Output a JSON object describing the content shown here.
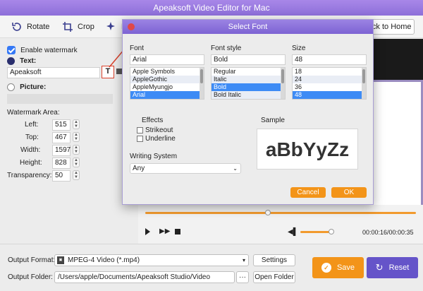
{
  "window": {
    "title": "Apeaksoft Video Editor for Mac"
  },
  "toolbar": {
    "rotate": "Rotate",
    "crop": "Crop",
    "effect_partial": "E",
    "back": "Back to Home"
  },
  "watermark": {
    "enable_label": "Enable watermark",
    "text_label": "Text:",
    "text_value": "Apeaksoft",
    "picture_label": "Picture:",
    "area_label": "Watermark Area:",
    "left_label": "Left:",
    "left_value": "515",
    "top_label": "Top:",
    "top_value": "467",
    "width_label": "Width:",
    "width_value": "1597",
    "height_label": "Height:",
    "height_value": "828",
    "transparency_label": "Transparency:",
    "transparency_value": "50"
  },
  "dialog": {
    "title": "Select Font",
    "font_label": "Font",
    "font_value": "Arial",
    "fonts": [
      "Apple Symbols",
      "AppleGothic",
      "AppleMyungjo",
      "Arial"
    ],
    "style_label": "Font style",
    "style_value": "Bold",
    "styles": [
      "Regular",
      "Italic",
      "Bold",
      "Bold Italic"
    ],
    "size_label": "Size",
    "size_value": "48",
    "sizes": [
      "18",
      "24",
      "36",
      "48"
    ],
    "effects_label": "Effects",
    "strikeout": "Strikeout",
    "underline": "Underline",
    "writing_label": "Writing System",
    "writing_value": "Any",
    "sample_label": "Sample",
    "sample_text": "aBbYyZz",
    "cancel": "Cancel",
    "ok": "OK"
  },
  "player": {
    "time": "00:00:16/00:00:35"
  },
  "output": {
    "format_label": "Output Format:",
    "format_value": "MPEG-4 Video (*.mp4)",
    "settings": "Settings",
    "folder_label": "Output Folder:",
    "folder_value": "/Users/apple/Documents/Apeaksoft Studio/Video",
    "ellipsis": "···",
    "open_folder": "Open Folder",
    "save": "Save",
    "reset": "Reset"
  },
  "colors": {
    "accent": "#f39419",
    "purple": "#6554c9",
    "highlight": "#d9412b"
  }
}
